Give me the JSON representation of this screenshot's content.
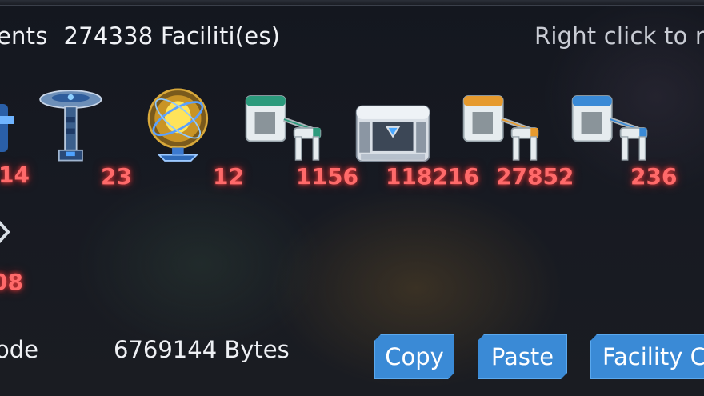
{
  "header": {
    "left_label": "ents",
    "facility_count": "274338 Faciliti(es)",
    "right_hint": "Right click to r"
  },
  "items": [
    {
      "icon": "partial-blueprint-icon",
      "qty": "14"
    },
    {
      "icon": "signal-tower-icon",
      "qty": "23"
    },
    {
      "icon": "golden-orb-icon",
      "qty": "12"
    },
    {
      "icon": "green-sorter-icon",
      "qty": "1156"
    },
    {
      "icon": "storage-chest-icon",
      "qty": "118216"
    },
    {
      "icon": "orange-sorter-icon",
      "qty": "27852"
    },
    {
      "icon": "blue-sorter-icon",
      "qty": "236"
    },
    {
      "icon": "partial-diamond-icon",
      "qty": "08"
    }
  ],
  "footer": {
    "label": "ode",
    "bytes": "6769144  Bytes",
    "copy_label": "Copy",
    "paste_label": "Paste",
    "facility_label": "Facility C"
  },
  "colors": {
    "quantity": "#ff6a6a",
    "button": "#3a8ad6",
    "background": "#171a22"
  }
}
